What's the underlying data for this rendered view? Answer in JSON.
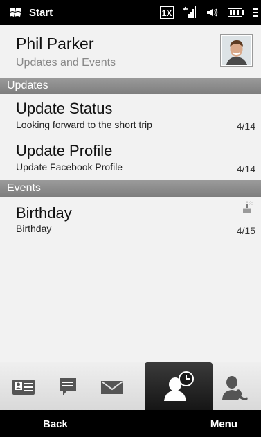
{
  "status_bar": {
    "start_label": "Start",
    "icons": [
      "windows-logo-icon",
      "1x-network-icon",
      "signal-strength-icon",
      "speaker-icon",
      "battery-icon",
      "menu-icon"
    ],
    "network_label": "1X"
  },
  "contact": {
    "name": "Phil Parker",
    "subtitle": "Updates and Events"
  },
  "sections": {
    "updates": "Updates",
    "events": "Events"
  },
  "updates": [
    {
      "title": "Update Status",
      "detail": "Looking forward to the short trip",
      "date": "4/14"
    },
    {
      "title": "Update Profile",
      "detail": "Update Facebook Profile",
      "date": "4/14"
    }
  ],
  "events": [
    {
      "title": "Birthday",
      "detail": "Birthday",
      "date": "4/15",
      "icon": "birthday-cake-icon"
    }
  ],
  "tabs": [
    {
      "icon": "contact-card-icon",
      "active": false
    },
    {
      "icon": "message-icon",
      "active": false
    },
    {
      "icon": "email-icon",
      "active": false
    },
    {
      "icon": "updates-events-icon",
      "active": true
    },
    {
      "icon": "call-history-icon",
      "active": false
    }
  ],
  "softkeys": {
    "left": "Back",
    "right": "Menu"
  },
  "colors": {
    "background": "#f2f2f2",
    "section_header": "#8a8a8a",
    "bars": "#000000"
  }
}
